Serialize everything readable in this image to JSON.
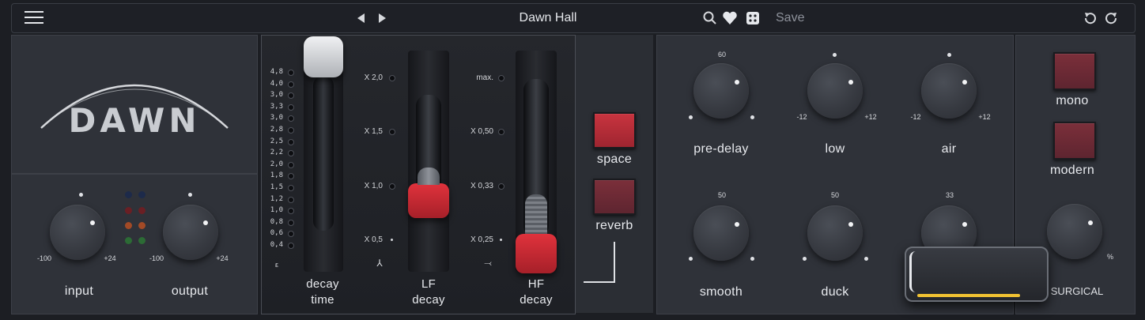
{
  "topbar": {
    "preset_name": "Dawn Hall",
    "save_label": "Save"
  },
  "logo": {
    "text": "DAWN"
  },
  "io": {
    "input": {
      "label": "input",
      "min": "-100",
      "max": "+24"
    },
    "output": {
      "label": "output",
      "min": "-100",
      "max": "+24"
    }
  },
  "faders": {
    "decay_time": {
      "label_1": "decay",
      "label_2": "time",
      "scale": [
        "4,8",
        "4,0",
        "3,0",
        "3,3",
        "3,0",
        "2,8",
        "2,5",
        "2,2",
        "2,0",
        "1,8",
        "1,5",
        "1,2",
        "1,0",
        "0,8",
        "0,6",
        "0,4"
      ],
      "bottom_glyph": "ε"
    },
    "lf_decay": {
      "label_1": "LF",
      "label_2": "decay",
      "scale": [
        "X 2,0",
        "X 1,5",
        "X 1,0",
        "X 0,5"
      ],
      "bottom_glyph": "⅄"
    },
    "hf_decay": {
      "label_1": "HF",
      "label_2": "decay",
      "scale": [
        "max.",
        "X 0,50",
        "X 0,33",
        "X 0,25"
      ],
      "bottom_glyph": "⤙"
    }
  },
  "toggles": {
    "space": {
      "label": "space",
      "state": "on"
    },
    "reverb": {
      "label": "reverb",
      "state": "off"
    }
  },
  "knobs": {
    "pre_delay": {
      "label": "pre-delay",
      "top": "60"
    },
    "low": {
      "label": "low",
      "min": "-12",
      "max": "+12"
    },
    "air": {
      "label": "air",
      "min": "-12",
      "max": "+12"
    },
    "smooth": {
      "label": "smooth",
      "top": "50"
    },
    "duck": {
      "label": "duck",
      "top": "50"
    },
    "third": {
      "top": "33"
    }
  },
  "right": {
    "mono": {
      "label": "mono"
    },
    "modern": {
      "label": "modern"
    },
    "bottom_label": "SURGICAL",
    "bottom_max": "%"
  },
  "colors": {
    "accent_red": "#c8343f",
    "dark_red": "#6a2833",
    "panel": "#2f3239",
    "overlay_yellow": "#f1c232"
  },
  "icons": [
    "menu-icon",
    "prev-arrow-icon",
    "next-arrow-icon",
    "search-icon",
    "heart-icon",
    "dice-icon",
    "undo-icon",
    "redo-icon"
  ]
}
